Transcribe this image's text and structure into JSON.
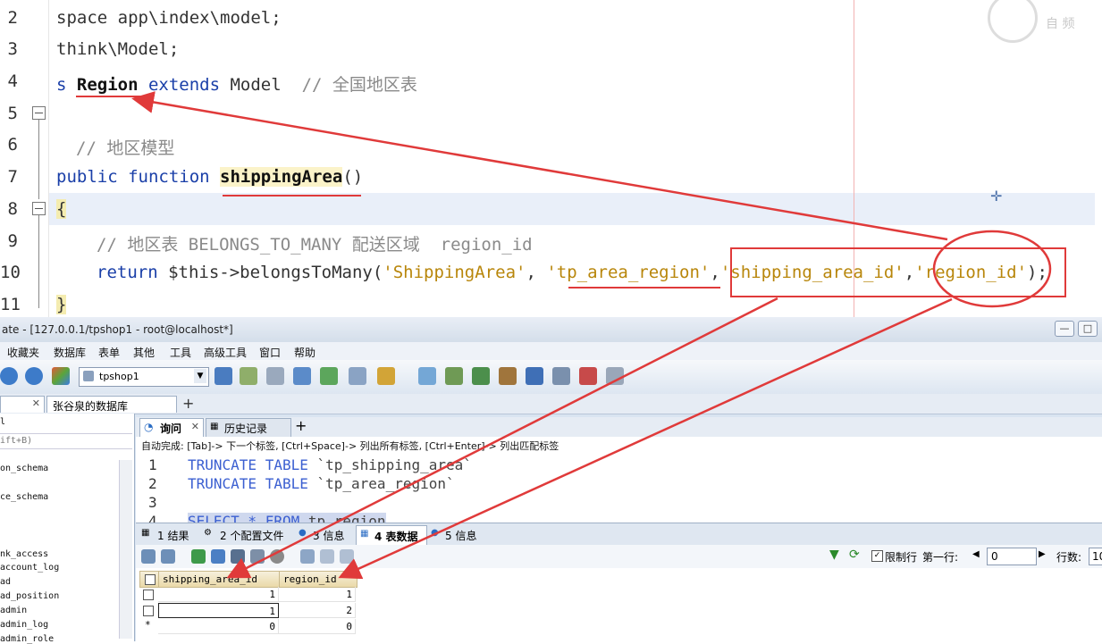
{
  "editor": {
    "line_numbers": [
      "2",
      "3",
      "4",
      "5",
      "6",
      "7",
      "8",
      "9",
      "10",
      "11"
    ],
    "lines": {
      "l2": "space app\\index\\model;",
      "l3": "think\\Model;",
      "l4_pre": "s ",
      "l4_class": "Region",
      "l4_extends": " extends ",
      "l4_model": "Model",
      "l4_comment": "  // 全国地区表",
      "l6_comment": "// 地区模型",
      "l7_kw": "public function ",
      "l7_fn": "shippingArea",
      "l7_paren": "()",
      "l8": "{",
      "l9_comment": "// 地区表 BELONGS_TO_MANY 配送区域  region_id",
      "l10_return": "return ",
      "l10_call": "$this->belongsToMany(",
      "l10_a1": "'ShippingArea'",
      "l10_sep1": ", ",
      "l10_a2": "'tp_area_region'",
      "l10_sep2": ",",
      "l10_a3": "'shipping_area_id'",
      "l10_sep3": ",",
      "l10_a4": "'region_id'",
      "l10_end": ");",
      "l11": "}"
    },
    "watermark": "自 频"
  },
  "window": {
    "title": "ate - [127.0.0.1/tpshop1 - root@localhost*]",
    "buttons": [
      "—",
      "□"
    ]
  },
  "menu": [
    "收藏夹",
    "数据库",
    "表单",
    "其他",
    "工具",
    "高级工具",
    "窗口",
    "帮助"
  ],
  "toolbar": {
    "db_selected": "tpshop1"
  },
  "connection_tab": "张谷泉的数据库",
  "left_pane": {
    "filter_hint": "ift+B)",
    "items": [
      "on_schema",
      "ce_schema",
      "nk_access",
      "account_log",
      "ad",
      "ad_position",
      "admin",
      "admin_log",
      "admin_role"
    ],
    "first_item": "l"
  },
  "query_tabs": [
    "询问",
    "历史记录"
  ],
  "autocomplete_hint": "自动完成: [Tab]-> 下一个标签, [Ctrl+Space]-> 列出所有标签, [Ctrl+Enter]-> 列出匹配标签",
  "sql": {
    "lines": [
      {
        "n": "1",
        "kw": "TRUNCATE TABLE ",
        "id": "`tp_shipping_area`"
      },
      {
        "n": "2",
        "kw": "TRUNCATE TABLE ",
        "id": "`tp_area_region`"
      },
      {
        "n": "3",
        "kw": "",
        "id": ""
      },
      {
        "n": "4",
        "kw": "SELECT * FROM ",
        "id": "tp_region"
      }
    ]
  },
  "result_tabs": [
    "1 结果",
    "2 个配置文件",
    "3 信息",
    "4 表数据",
    "5 信息"
  ],
  "result_bar": {
    "readonly_label": "限制行",
    "first_row_label": "第一行:",
    "first_row_value": "0",
    "rows_label": "行数:",
    "rows_value": "10"
  },
  "grid": {
    "columns": [
      "shipping_area_id",
      "region_id"
    ],
    "rows": [
      [
        "1",
        "1"
      ],
      [
        "1",
        "2"
      ],
      [
        "0",
        "0"
      ]
    ]
  },
  "colors": {
    "accent_red": "#e03a3a",
    "keyword_blue": "#1a3fa8",
    "string_gold": "#b8860b"
  }
}
